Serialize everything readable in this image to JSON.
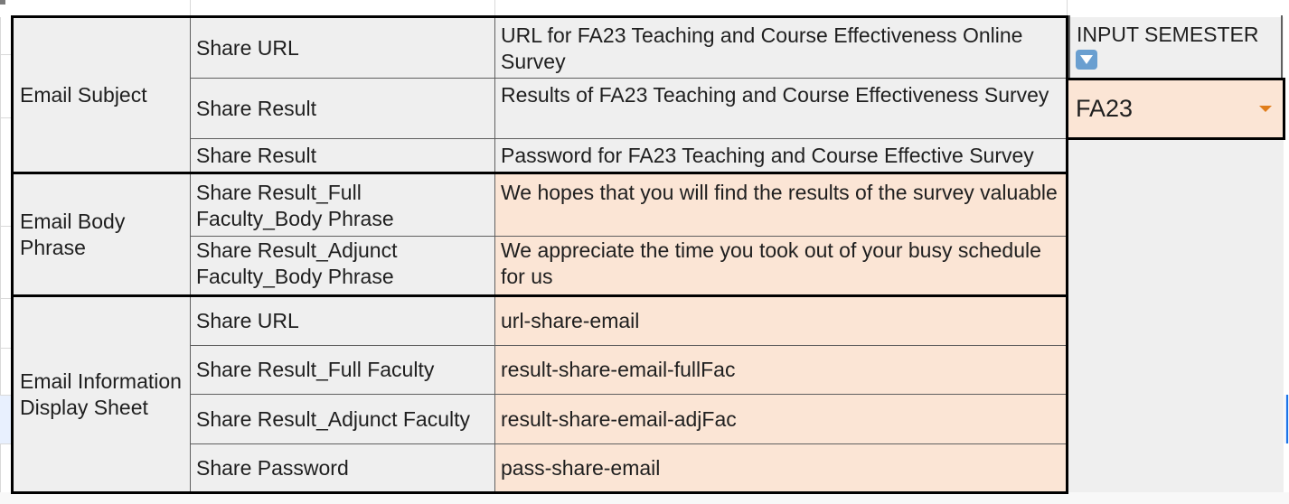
{
  "table": {
    "groups": [
      {
        "label": "Email Subject",
        "rows": [
          {
            "key": "Share URL",
            "value": "URL for FA23 Teaching and Course Effectiveness Online Survey"
          },
          {
            "key": "Share Result",
            "value": "Results of FA23 Teaching and Course Effectiveness Survey"
          },
          {
            "key": "Share Result",
            "value": "Password for FA23 Teaching and Course Effective Survey"
          }
        ]
      },
      {
        "label": "Email Body Phrase",
        "rows": [
          {
            "key": "Share Result_Full Faculty_Body Phrase",
            "value": "We hopes that you will find the results of the survey valuable"
          },
          {
            "key": "Share Result_Adjunct Faculty_Body Phrase",
            "value": "We appreciate the time you took out of your busy schedule for us"
          }
        ]
      },
      {
        "label": "Email Information Display Sheet",
        "rows": [
          {
            "key": "Share URL",
            "value": "url-share-email"
          },
          {
            "key": "Share Result_Full Faculty",
            "value": "result-share-email-fullFac"
          },
          {
            "key": "Share Result_Adjunct Faculty",
            "value": "result-share-email-adjFac"
          },
          {
            "key": "Share Password",
            "value": "pass-share-email"
          }
        ]
      }
    ]
  },
  "semester_panel": {
    "label": "INPUT SEMESTER",
    "icon": "down-arrow-emoji-icon",
    "selected": "FA23"
  },
  "colors": {
    "label_bg": "#efefef",
    "value_bg": "#fbe5d5",
    "dropdown_arrow": "#e07d1a"
  }
}
